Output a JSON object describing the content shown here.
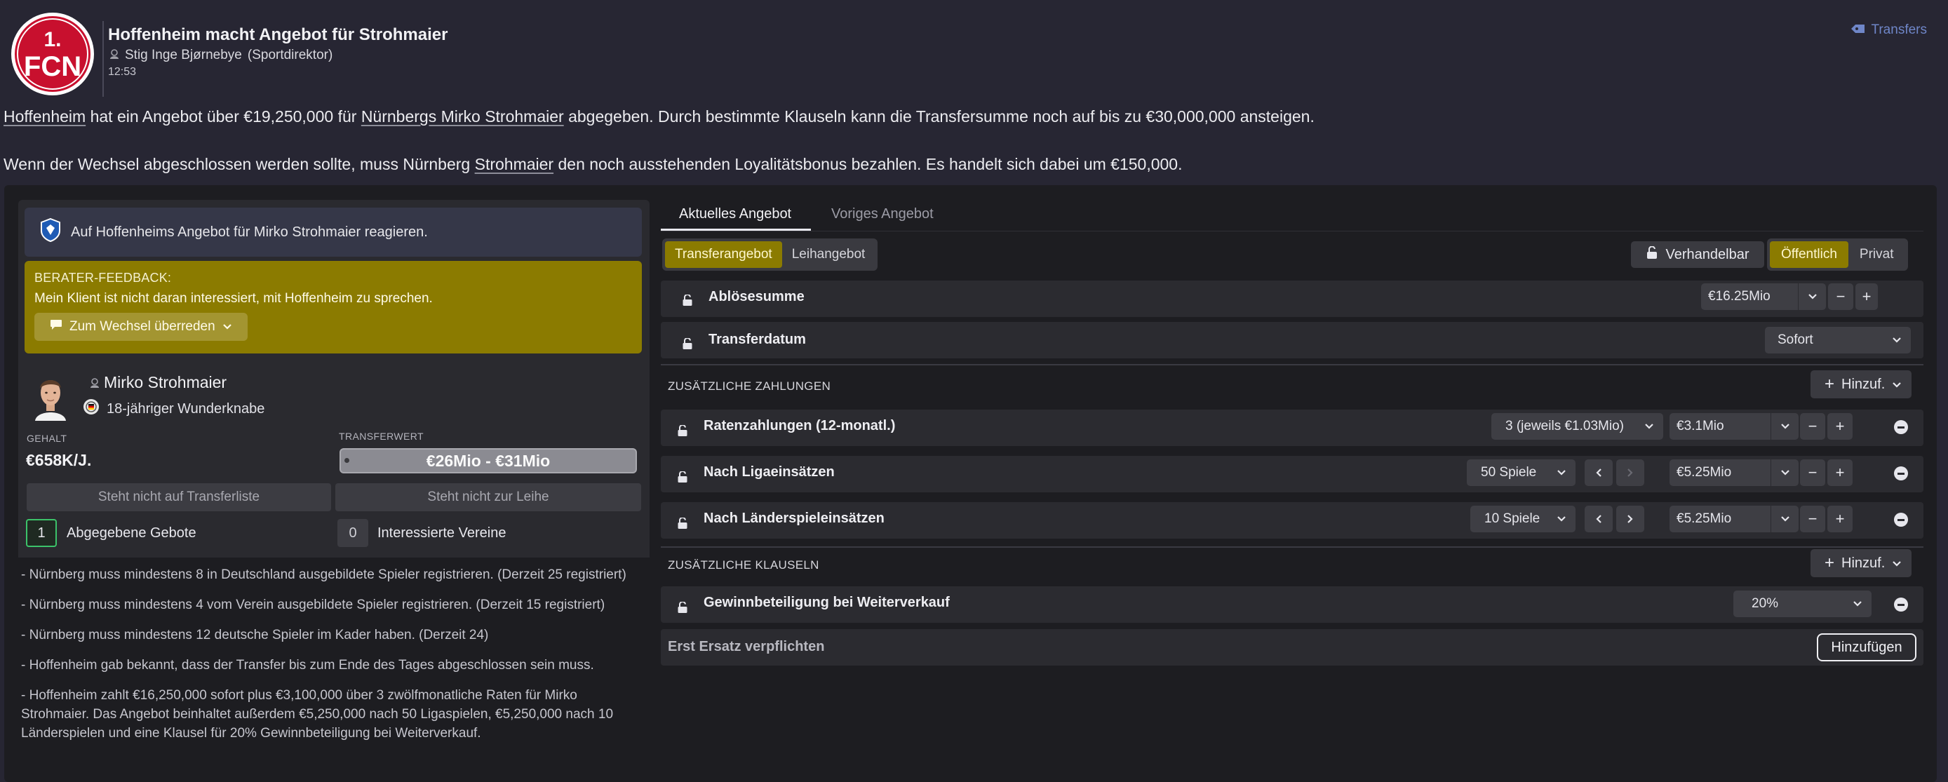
{
  "header": {
    "title": "Hoffenheim macht Angebot für Strohmaier",
    "author": "Stig Inge Bjørnebye",
    "author_role": "(Sportdirektor)",
    "time": "12:53",
    "transfers_link": "Transfers",
    "club_logo_text": "FCN",
    "club_logo_number": "1."
  },
  "message": {
    "line1_club": "Hoffenheim",
    "line1_a": " hat ein Angebot über €19,250,000 für ",
    "line1_player": "Nürnbergs Mirko Strohmaier",
    "line1_b": " abgegeben. Durch bestimmte Klauseln kann die Transfersumme noch auf bis zu €30,000,000 ansteigen.",
    "line2_a": "Wenn der Wechsel abgeschlossen werden sollte, muss Nürnberg ",
    "line2_player": "Strohmaier",
    "line2_b": " den noch ausstehenden Loyalitätsbonus bezahlen. Es handelt sich dabei um €150,000."
  },
  "left": {
    "react_text": "Auf Hoffenheims Angebot für Mirko Strohmaier reagieren.",
    "feedback_label": "BERATER-FEEDBACK:",
    "feedback_text": "Mein Klient ist nicht daran interessiert, mit Hoffenheim zu sprechen.",
    "persuade_button": "Zum Wechsel überreden",
    "player_name": "Mirko Strohmaier",
    "player_sub": "18-jähriger Wunderknabe",
    "salary_label": "GEHALT",
    "salary_value": "€658K/J.",
    "transfer_value_label": "TRANSFERWERT",
    "transfer_value": "€26Mio - €31Mio",
    "not_listed_button": "Steht nicht auf Transferliste",
    "not_loan_button": "Steht nicht zur Leihe",
    "bids_count": "1",
    "bids_label": "Abgegebene Gebote",
    "clubs_count": "0",
    "clubs_label": "Interessierte Vereine",
    "clauses": [
      "- Nürnberg muss mindestens 8 in Deutschland ausgebildete Spieler registrieren. (Derzeit 25 registriert)",
      "- Nürnberg muss mindestens 4 vom Verein ausgebildete Spieler registrieren. (Derzeit 15 registriert)",
      "- Nürnberg muss mindestens 12 deutsche Spieler im Kader haben. (Derzeit 24)",
      "- Hoffenheim gab bekannt, dass der Transfer bis zum Ende des Tages abgeschlossen sein muss.",
      "- Hoffenheim zahlt €16,250,000 sofort plus €3,100,000 über 3 zwölfmonatliche Raten für Mirko Strohmaier. Das Angebot beinhaltet außerdem €5,250,000 nach 50 Ligaspielen, €5,250,000 nach 10 Länderspielen und eine Klausel für 20% Gewinnbeteiligung bei Weiterverkauf."
    ]
  },
  "right": {
    "tabs": [
      "Aktuelles Angebot",
      "Voriges Angebot"
    ],
    "offer_types": [
      "Transferangebot",
      "Leihangebot"
    ],
    "negotiable": "Verhandelbar",
    "visibility": [
      "Öffentlich",
      "Privat"
    ],
    "fee_label": "Ablösesumme",
    "fee_value": "€16.25Mio",
    "date_label": "Transferdatum",
    "date_value": "Sofort",
    "extra_payments_header": "ZUSÄTZLICHE ZAHLUNGEN",
    "add_label": "Hinzuf.",
    "installments_label": "Ratenzahlungen (12-monatl.)",
    "installments_select": "3 (jeweils €1.03Mio)",
    "installments_value": "€3.1Mio",
    "league_label": "Nach Ligaeinsätzen",
    "league_select": "50 Spiele",
    "league_value": "€5.25Mio",
    "intl_label": "Nach Länderspieleinsätzen",
    "intl_select": "10 Spiele",
    "intl_value": "€5.25Mio",
    "extra_clauses_header": "ZUSÄTZLICHE KLAUSELN",
    "sellon_label": "Gewinnbeteiligung bei Weiterverkauf",
    "sellon_value": "20%",
    "replacement_label": "Erst Ersatz verpflichten",
    "add_full_button": "Hinzufügen"
  },
  "colors": {
    "background": "#272633",
    "accent_gold": "#8b7b00",
    "link_blue": "#6f86c8",
    "club_red": "#c8102e",
    "positive_green": "#3cc36a"
  }
}
